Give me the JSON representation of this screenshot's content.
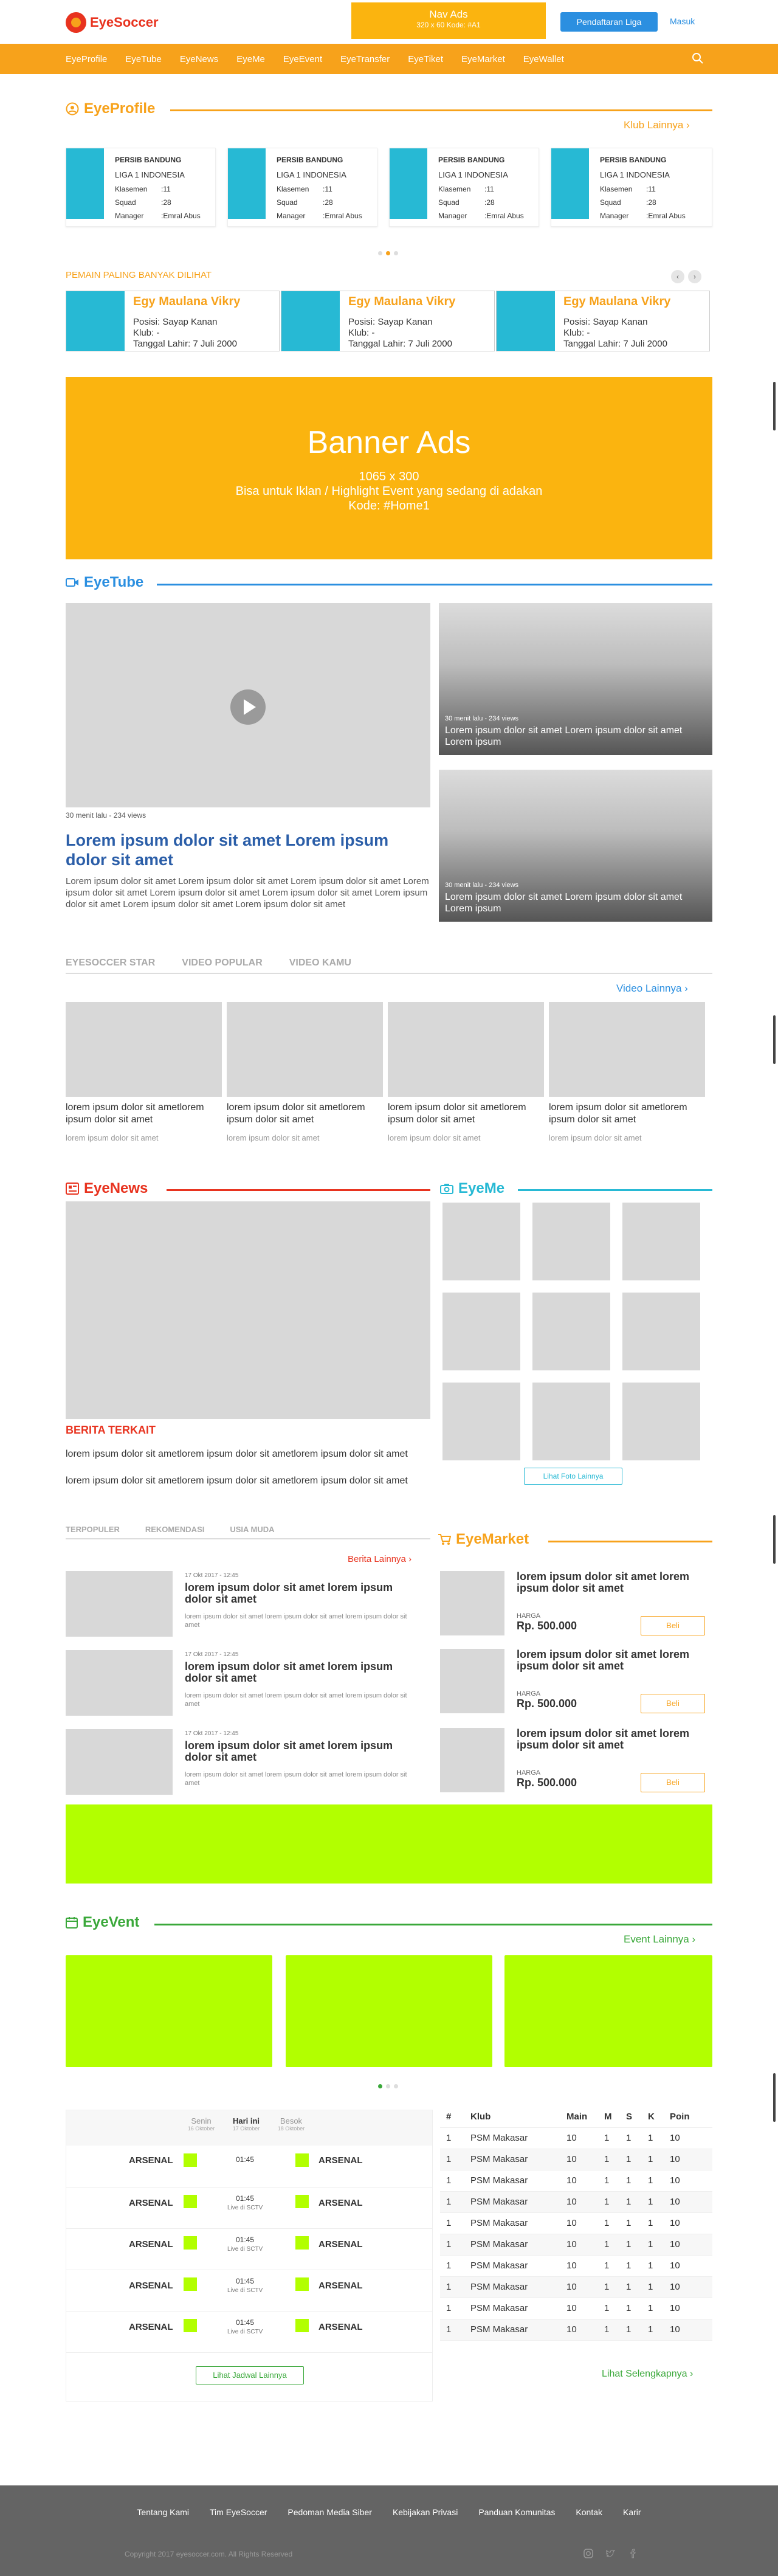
{
  "header": {
    "logo": "EyeSoccer",
    "nav_ads_title": "Nav Ads",
    "nav_ads_sub": "320 x 60 Kode: #A1",
    "register_label": "Pendaftaran Liga",
    "login_label": "Masuk"
  },
  "nav": [
    "EyeProfile",
    "EyeTube",
    "EyeNews",
    "EyeMe",
    "EyeEvent",
    "EyeTransfer",
    "EyeTiket",
    "EyeMarket",
    "EyeWallet"
  ],
  "profile": {
    "title": "EyeProfile",
    "more": "Klub Lainnya",
    "cards": [
      {
        "club": "PERSIB BANDUNG",
        "league": "LIGA 1 INDONESIA",
        "rows": [
          [
            "Klasemen",
            ":11"
          ],
          [
            "Squad",
            ":28"
          ],
          [
            "Manager",
            ":Emral Abus"
          ]
        ]
      },
      {
        "club": "PERSIB BANDUNG",
        "league": "LIGA 1 INDONESIA",
        "rows": [
          [
            "Klasemen",
            ":11"
          ],
          [
            "Squad",
            ":28"
          ],
          [
            "Manager",
            ":Emral Abus"
          ]
        ]
      },
      {
        "club": "PERSIB BANDUNG",
        "league": "LIGA 1 INDONESIA",
        "rows": [
          [
            "Klasemen",
            ":11"
          ],
          [
            "Squad",
            ":28"
          ],
          [
            "Manager",
            ":Emral Abus"
          ]
        ]
      },
      {
        "club": "PERSIB BANDUNG",
        "league": "LIGA 1 INDONESIA",
        "rows": [
          [
            "Klasemen",
            ":11"
          ],
          [
            "Squad",
            ":28"
          ],
          [
            "Manager",
            ":Emral Abus"
          ]
        ]
      }
    ]
  },
  "most_viewed": {
    "title": "PEMAIN PALING BANYAK DILIHAT",
    "players": [
      {
        "name": "Egy Maulana Vikry",
        "posisi": "Posisi: Sayap Kanan",
        "klub": "Klub: -",
        "lahir": "Tanggal Lahir: 7 Juli 2000"
      },
      {
        "name": "Egy Maulana Vikry",
        "posisi": "Posisi: Sayap Kanan",
        "klub": "Klub: -",
        "lahir": "Tanggal Lahir: 7 Juli 2000"
      },
      {
        "name": "Egy Maulana Vikry",
        "posisi": "Posisi: Sayap Kanan",
        "klub": "Klub: -",
        "lahir": "Tanggal Lahir: 7 Juli 2000"
      }
    ]
  },
  "banner": {
    "title": "Banner Ads",
    "size": "1065 x 300",
    "desc": "Bisa untuk Iklan / Highlight Event yang sedang di adakan",
    "code": "Kode: #Home1"
  },
  "eyetube": {
    "title": "EyeTube",
    "main_meta": "30 menit lalu - 234 views",
    "main_title": "Lorem ipsum dolor sit amet Lorem ipsum dolor sit amet",
    "main_desc": "Lorem ipsum dolor sit amet Lorem ipsum dolor sit amet Lorem ipsum dolor sit amet Lorem ipsum dolor sit amet Lorem ipsum dolor sit amet Lorem ipsum dolor sit amet Lorem ipsum dolor sit amet Lorem ipsum dolor sit amet Lorem ipsum dolor sit amet",
    "side": [
      {
        "meta": "30 menit lalu - 234 views",
        "title": "Lorem ipsum dolor sit amet Lorem ipsum dolor sit amet Lorem ipsum"
      },
      {
        "meta": "30 menit lalu - 234 views",
        "title": "Lorem ipsum dolor sit amet Lorem ipsum dolor sit amet Lorem ipsum"
      }
    ],
    "tabs": [
      "EYESOCCER STAR",
      "VIDEO POPULAR",
      "VIDEO KAMU"
    ],
    "more": "Video Lainnya",
    "videos": [
      {
        "title": "lorem ipsum dolor sit ametlorem ipsum dolor sit amet",
        "sub": "lorem ipsum dolor sit amet"
      },
      {
        "title": "lorem ipsum dolor sit ametlorem ipsum dolor sit amet",
        "sub": "lorem ipsum dolor sit amet"
      },
      {
        "title": "lorem ipsum dolor sit ametlorem ipsum dolor sit amet",
        "sub": "lorem ipsum dolor sit amet"
      },
      {
        "title": "lorem ipsum dolor sit ametlorem ipsum dolor sit amet",
        "sub": "lorem ipsum dolor sit amet"
      }
    ]
  },
  "eyenews": {
    "title": "EyeNews",
    "related_label": "BERITA TERKAIT",
    "related": [
      "lorem ipsum dolor sit ametlorem ipsum dolor sit ametlorem ipsum dolor sit amet",
      "lorem ipsum dolor sit ametlorem ipsum dolor sit ametlorem ipsum dolor sit amet"
    ],
    "tabs": [
      "TERPOPULER",
      "REKOMENDASI",
      "USIA MUDA"
    ],
    "more": "Berita Lainnya",
    "items": [
      {
        "date": "17 Okt 2017 - 12:45",
        "title": "lorem ipsum dolor sit amet lorem ipsum dolor sit amet",
        "desc": "lorem ipsum dolor sit amet lorem ipsum dolor sit amet lorem ipsum dolor sit amet"
      },
      {
        "date": "17 Okt 2017 - 12:45",
        "title": "lorem ipsum dolor sit amet lorem ipsum dolor sit amet",
        "desc": "lorem ipsum dolor sit amet lorem ipsum dolor sit amet lorem ipsum dolor sit amet"
      },
      {
        "date": "17 Okt 2017 - 12:45",
        "title": "lorem ipsum dolor sit amet lorem ipsum dolor sit amet",
        "desc": "lorem ipsum dolor sit amet lorem ipsum dolor sit amet lorem ipsum dolor sit amet"
      }
    ]
  },
  "eyeme": {
    "title": "EyeMe",
    "more": "Lihat Foto Lainnya"
  },
  "eyemarket": {
    "title": "EyeMarket",
    "items": [
      {
        "title": "lorem ipsum dolor sit amet lorem ipsum dolor sit amet",
        "price_label": "HARGA",
        "price": "Rp. 500.000",
        "buy": "Beli"
      },
      {
        "title": "lorem ipsum dolor sit amet lorem ipsum dolor sit amet",
        "price_label": "HARGA",
        "price": "Rp. 500.000",
        "buy": "Beli"
      },
      {
        "title": "lorem ipsum dolor sit amet lorem ipsum dolor sit amet",
        "price_label": "HARGA",
        "price": "Rp. 500.000",
        "buy": "Beli"
      }
    ]
  },
  "eyevent": {
    "title": "EyeVent",
    "more": "Event Lainnya"
  },
  "schedule": {
    "days": [
      {
        "day": "Senin",
        "date": "16 Oktober"
      },
      {
        "day": "Hari ini",
        "date": "17 Oktober"
      },
      {
        "day": "Besok",
        "date": "18 Oktober"
      }
    ],
    "matches": [
      {
        "home": "ARSENAL",
        "away": "ARSENAL",
        "time": "01:45",
        "tv": ""
      },
      {
        "home": "ARSENAL",
        "away": "ARSENAL",
        "time": "01:45",
        "tv": "Live di SCTV"
      },
      {
        "home": "ARSENAL",
        "away": "ARSENAL",
        "time": "01:45",
        "tv": "Live di SCTV"
      },
      {
        "home": "ARSENAL",
        "away": "ARSENAL",
        "time": "01:45",
        "tv": "Live di SCTV"
      },
      {
        "home": "ARSENAL",
        "away": "ARSENAL",
        "time": "01:45",
        "tv": "Live di SCTV"
      }
    ],
    "more": "Lihat Jadwal Lainnya"
  },
  "standings": {
    "headers": [
      "#",
      "Klub",
      "Main",
      "M",
      "S",
      "K",
      "Poin"
    ],
    "rows": [
      [
        "1",
        "PSM Makasar",
        "10",
        "1",
        "1",
        "1",
        "10"
      ],
      [
        "1",
        "PSM Makasar",
        "10",
        "1",
        "1",
        "1",
        "10"
      ],
      [
        "1",
        "PSM Makasar",
        "10",
        "1",
        "1",
        "1",
        "10"
      ],
      [
        "1",
        "PSM Makasar",
        "10",
        "1",
        "1",
        "1",
        "10"
      ],
      [
        "1",
        "PSM Makasar",
        "10",
        "1",
        "1",
        "1",
        "10"
      ],
      [
        "1",
        "PSM Makasar",
        "10",
        "1",
        "1",
        "1",
        "10"
      ],
      [
        "1",
        "PSM Makasar",
        "10",
        "1",
        "1",
        "1",
        "10"
      ],
      [
        "1",
        "PSM Makasar",
        "10",
        "1",
        "1",
        "1",
        "10"
      ],
      [
        "1",
        "PSM Makasar",
        "10",
        "1",
        "1",
        "1",
        "10"
      ],
      [
        "1",
        "PSM Makasar",
        "10",
        "1",
        "1",
        "1",
        "10"
      ]
    ],
    "more": "Lihat Selengkapnya"
  },
  "footer": {
    "links": [
      "Tentang Kami",
      "Tim EyeSoccer",
      "Pedoman Media Siber",
      "Kebijakan Privasi",
      "Panduan Komunitas",
      "Kontak",
      "Karir"
    ],
    "copyright": "Copyright 2017 eyesoccer.com. All Rights Reserved"
  },
  "colors": {
    "orange": "#f7a21b",
    "blue": "#2b8fe0",
    "red": "#e8331f",
    "lime": "#b2ff00",
    "teal": "#27b9d4",
    "green": "#3aa83a"
  }
}
